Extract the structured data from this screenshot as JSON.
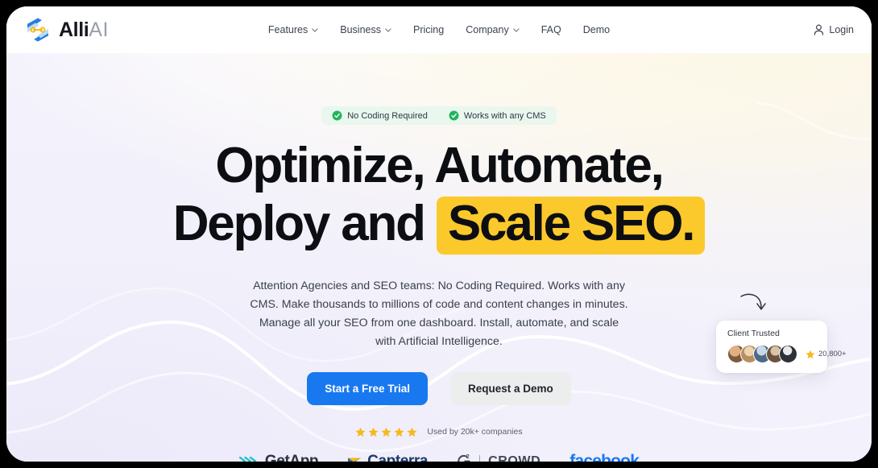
{
  "brand": {
    "name_bold": "Alli",
    "name_light": "AI",
    "logo_icon": "alliai-hexagon-logo"
  },
  "nav": {
    "items": [
      {
        "label": "Features",
        "has_dropdown": true
      },
      {
        "label": "Business",
        "has_dropdown": true
      },
      {
        "label": "Pricing",
        "has_dropdown": false
      },
      {
        "label": "Company",
        "has_dropdown": true
      },
      {
        "label": "FAQ",
        "has_dropdown": false
      },
      {
        "label": "Demo",
        "has_dropdown": false
      }
    ],
    "login_label": "Login",
    "login_icon": "user-icon"
  },
  "hero": {
    "badges": [
      {
        "label": "No Coding Required",
        "icon": "check-circle-icon"
      },
      {
        "label": "Works with any CMS",
        "icon": "check-circle-icon"
      }
    ],
    "headline_line1": "Optimize, Automate,",
    "headline_line2_prefix": "Deploy and ",
    "headline_highlight": "Scale SEO.",
    "subtext": "Attention Agencies and SEO teams: No Coding Required. Works with any CMS. Make thousands to millions of code and content changes in minutes. Manage all your SEO from one dashboard. Install, automate, and scale with Artificial Intelligence.",
    "primary_cta": "Start a Free Trial",
    "secondary_cta": "Request a Demo",
    "rating_stars": 5,
    "rating_label": "Used by 20k+ companies"
  },
  "trusted": {
    "title": "Client Trusted",
    "count": "20,800+",
    "star_icon": "star-icon",
    "avatar_count": 5,
    "arrow_icon": "curved-arrow-icon"
  },
  "partners": [
    {
      "name": "GetApp",
      "icon": "getapp-chevrons-icon"
    },
    {
      "name": "Capterra",
      "icon": "capterra-arrow-icon"
    },
    {
      "name": "CROWD",
      "prefix": "G",
      "superscript": "2",
      "icon": "g2crowd-icon"
    },
    {
      "name": "facebook",
      "icon": "facebook-wordmark-icon"
    }
  ],
  "colors": {
    "primary_blue": "#1878f0",
    "highlight_yellow": "#fbc92b",
    "badge_green": "#22b35e",
    "badge_bg": "#e9f7ef",
    "facebook_blue": "#1877f2",
    "page_bg": "#f3f1fb"
  }
}
